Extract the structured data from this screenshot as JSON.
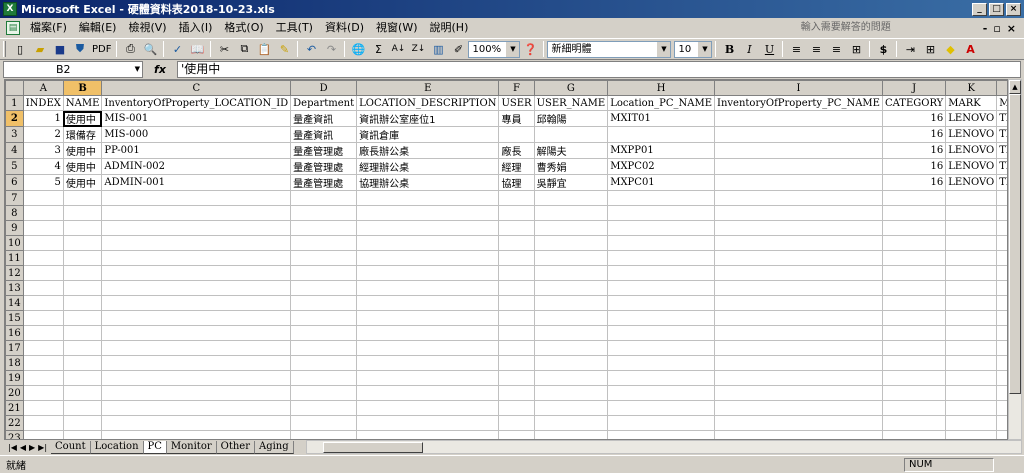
{
  "window": {
    "title": "Microsoft Excel - 硬體資料表2018-10-23.xls",
    "app_icon": "X"
  },
  "menu": {
    "items": [
      "檔案(F)",
      "編輯(E)",
      "檢視(V)",
      "插入(I)",
      "格式(O)",
      "工具(T)",
      "資料(D)",
      "視窗(W)",
      "說明(H)"
    ],
    "help_placeholder": "輸入需要解答的問題"
  },
  "toolbar": {
    "zoom": "100%",
    "font": "新細明體",
    "font_size": "10",
    "pdf_label": "PDF"
  },
  "formula": {
    "cell_ref": "B2",
    "fx": "fx",
    "value": "'使用中"
  },
  "columns": [
    "A",
    "B",
    "C",
    "D",
    "E",
    "F",
    "G",
    "H",
    "I",
    "J",
    "K",
    "L"
  ],
  "headers": [
    "INDEX",
    "NAME",
    "InventoryOfProperty_LOCATION_ID",
    "Department",
    "LOCATION_DESCRIPTION",
    "USER",
    "USER_NAME",
    "Location_PC_NAME",
    "InventoryOfProperty_PC_NAME",
    "CATEGORY",
    "MARK",
    "MODEL"
  ],
  "rows": [
    [
      "1",
      "使用中",
      "MIS-001",
      "量產資訊",
      "資訊辦公室座位1",
      "專員",
      "邱翰陽",
      "MXIT01",
      "",
      "16",
      "LENOVO",
      "ThinkCentre"
    ],
    [
      "2",
      "環備存",
      "MIS-000",
      "量產資訊",
      "資訊倉庫",
      "",
      "",
      "",
      "",
      "16",
      "LENOVO",
      "ThinkCentre"
    ],
    [
      "3",
      "使用中",
      "PP-001",
      "量產管理處",
      "廠長辦公桌",
      "廠長",
      "解陽夫",
      "MXPP01",
      "",
      "16",
      "LENOVO",
      "ThinkCentre"
    ],
    [
      "4",
      "使用中",
      "ADMIN-002",
      "量產管理處",
      "經理辦公桌",
      "經理",
      "曹秀娟",
      "MXPC02",
      "",
      "16",
      "LENOVO",
      "ThinkCentre"
    ],
    [
      "5",
      "使用中",
      "ADMIN-001",
      "量產管理處",
      "協理辦公桌",
      "協理",
      "吳靜宜",
      "MXPC01",
      "",
      "16",
      "LENOVO",
      "ThinkCentre"
    ]
  ],
  "row_count": 23,
  "sheet_tabs": [
    "Count",
    "Location",
    "PC",
    "Monitor",
    "Other",
    "Aging"
  ],
  "active_tab": "PC",
  "status": {
    "text": "就緒",
    "num": "NUM"
  }
}
